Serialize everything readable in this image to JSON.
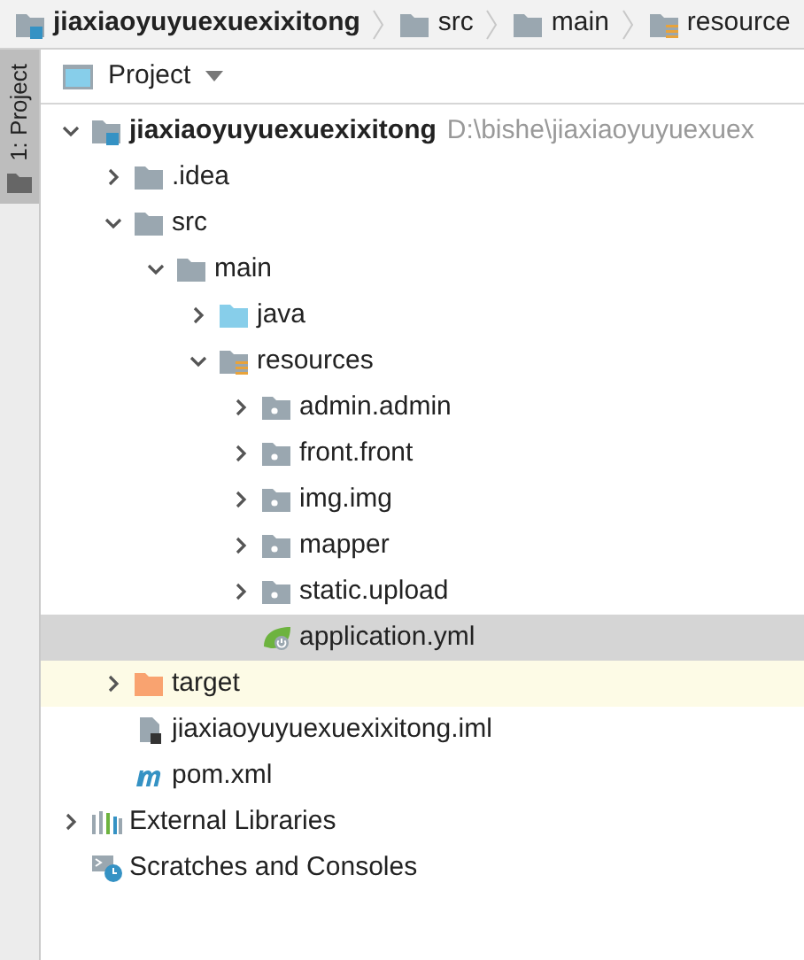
{
  "breadcrumb": [
    {
      "label": "jiaxiaoyuyuexuexixitong",
      "kind": "module"
    },
    {
      "label": "src",
      "kind": "folder"
    },
    {
      "label": "main",
      "kind": "folder"
    },
    {
      "label": "resource",
      "kind": "resources-folder"
    }
  ],
  "tool_strip": {
    "tab": {
      "label": "1: Project",
      "selected": true
    }
  },
  "panel": {
    "title": "Project"
  },
  "tree": [
    {
      "label": "jiaxiaoyuyuexuexixitong",
      "path": "D:\\bishe\\jiaxiaoyuyuexuex",
      "kind": "module",
      "expanded": true,
      "selected": false,
      "children": [
        {
          "label": ".idea",
          "kind": "folder",
          "expanded": false,
          "selected": false
        },
        {
          "label": "src",
          "kind": "folder",
          "expanded": true,
          "selected": false,
          "children": [
            {
              "label": "main",
              "kind": "folder",
              "expanded": true,
              "selected": false,
              "children": [
                {
                  "label": "java",
                  "kind": "source-folder",
                  "expanded": false,
                  "selected": false
                },
                {
                  "label": "resources",
                  "kind": "resources-folder",
                  "expanded": true,
                  "selected": false,
                  "children": [
                    {
                      "label": "admin.admin",
                      "kind": "package",
                      "expanded": false,
                      "selected": false
                    },
                    {
                      "label": "front.front",
                      "kind": "package",
                      "expanded": false,
                      "selected": false
                    },
                    {
                      "label": "img.img",
                      "kind": "package",
                      "expanded": false,
                      "selected": false
                    },
                    {
                      "label": "mapper",
                      "kind": "package",
                      "expanded": false,
                      "selected": false
                    },
                    {
                      "label": "static.upload",
                      "kind": "package",
                      "expanded": false,
                      "selected": false
                    },
                    {
                      "label": "application.yml",
                      "kind": "spring-config",
                      "selected": true
                    }
                  ]
                }
              ]
            }
          ]
        },
        {
          "label": "target",
          "kind": "excluded-folder",
          "expanded": false,
          "selected": false
        },
        {
          "label": "jiaxiaoyuyuexuexixitong.iml",
          "kind": "module-file",
          "selected": false
        },
        {
          "label": "pom.xml",
          "kind": "maven-file",
          "selected": false
        }
      ]
    },
    {
      "label": "External Libraries",
      "kind": "libraries",
      "expanded": false,
      "selected": false
    },
    {
      "label": "Scratches and Consoles",
      "kind": "scratches",
      "selected": false
    }
  ]
}
